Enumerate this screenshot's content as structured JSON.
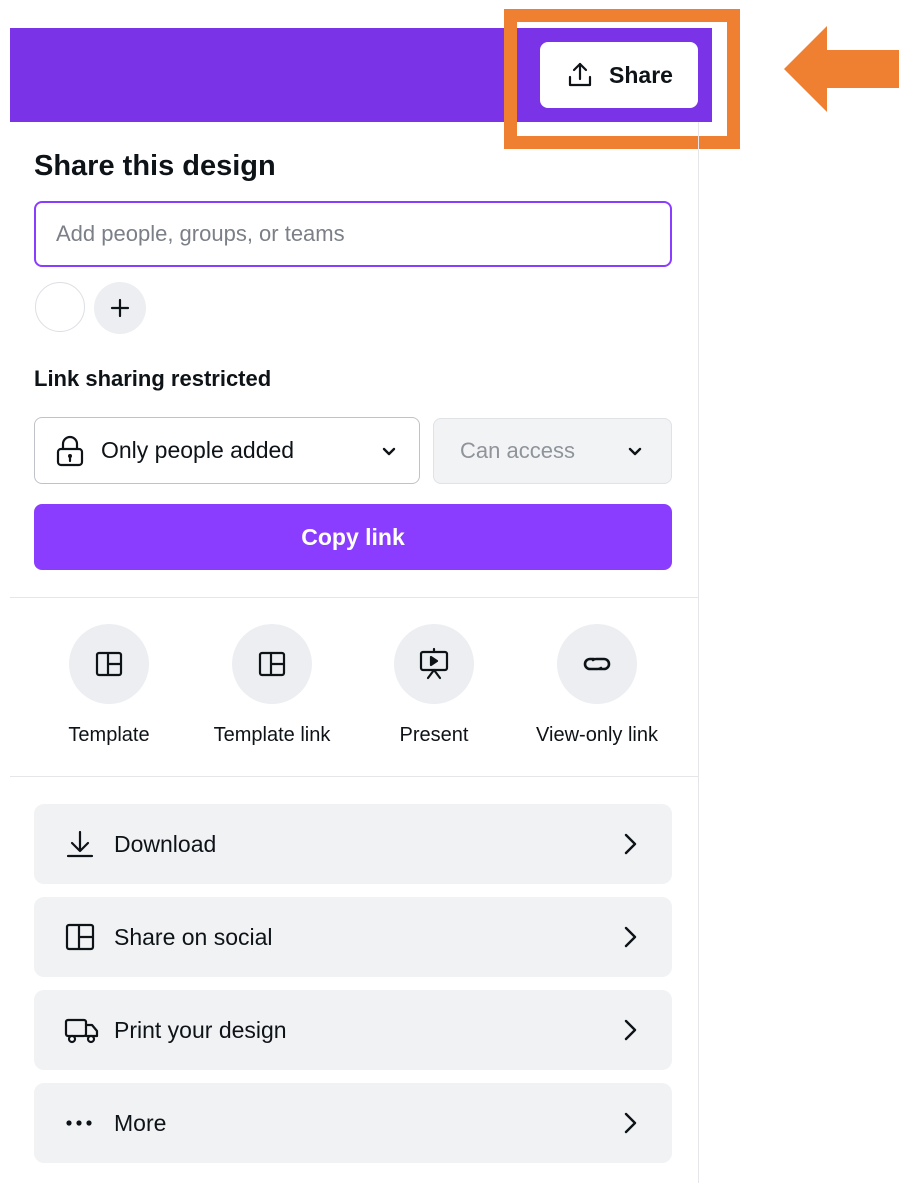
{
  "topbar": {
    "share_label": "Share",
    "color": "#7a33e6",
    "highlight_color": "#ef8032"
  },
  "panel": {
    "title": "Share this design",
    "people_input": {
      "value": "",
      "placeholder": "Add people, groups, or teams"
    },
    "add_person_icon": "plus-icon",
    "link_sharing_label": "Link sharing restricted",
    "access_select": {
      "value": "Only people added",
      "icon": "lock-icon"
    },
    "permission_select": {
      "value": "Can access",
      "disabled": true
    },
    "copy_link_label": "Copy link",
    "accent": "#8b3dff"
  },
  "actions": [
    {
      "label": "Template",
      "icon": "layout-icon"
    },
    {
      "label": "Template link",
      "icon": "layout-icon"
    },
    {
      "label": "Present",
      "icon": "present-icon"
    },
    {
      "label": "View-only link",
      "icon": "link-icon"
    }
  ],
  "rows": [
    {
      "label": "Download",
      "icon": "download-icon"
    },
    {
      "label": "Share on social",
      "icon": "layout-icon"
    },
    {
      "label": "Print your design",
      "icon": "truck-icon"
    },
    {
      "label": "More",
      "icon": "more-icon"
    }
  ]
}
